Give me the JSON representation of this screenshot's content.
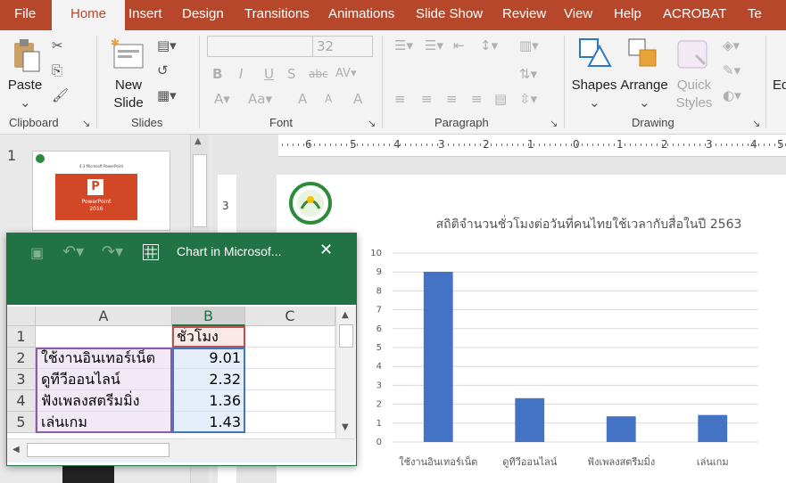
{
  "ribbon_tabs": [
    {
      "label": "File",
      "active": false
    },
    {
      "label": "Home",
      "active": true
    },
    {
      "label": "Insert",
      "active": false
    },
    {
      "label": "Design",
      "active": false
    },
    {
      "label": "Transitions",
      "active": false
    },
    {
      "label": "Animations",
      "active": false
    },
    {
      "label": "Slide Show",
      "active": false
    },
    {
      "label": "Review",
      "active": false
    },
    {
      "label": "View",
      "active": false
    },
    {
      "label": "Help",
      "active": false
    },
    {
      "label": "ACROBAT",
      "active": false
    },
    {
      "label": "Te",
      "active": false
    }
  ],
  "ribbon": {
    "groups": {
      "clipboard": "Clipboard",
      "slides": "Slides",
      "font": "Font",
      "paragraph": "Paragraph",
      "drawing": "Drawing"
    },
    "paste": "Paste",
    "new_slide_line1": "New",
    "new_slide_line2": "Slide",
    "font_size": "32",
    "shapes": "Shapes",
    "arrange": "Arrange",
    "quick_line1": "Quick",
    "quick_line2": "Styles",
    "edit_partial": "Ed"
  },
  "slide_panel": {
    "slide_number": "1",
    "thumb_title": "4.3 Microsoft PowerPoint",
    "thumb_logo_line1": "PowerPoint",
    "thumb_logo_line2": "2016"
  },
  "chart_window": {
    "title": "Chart in Microsof...",
    "columns": [
      "A",
      "B",
      "C"
    ],
    "rows": [
      {
        "num": "1",
        "a": "",
        "b": "ชั่วโมง"
      },
      {
        "num": "2",
        "a": "ใช้งานอินเทอร์เน็ต",
        "b": "9.01"
      },
      {
        "num": "3",
        "a": "ดูทีวีออนไลน์",
        "b": "2.32"
      },
      {
        "num": "4",
        "a": "ฟังเพลงสตรีมมิ่ง",
        "b": "1.36"
      },
      {
        "num": "5",
        "a": "เล่นเกม",
        "b": "1.43"
      }
    ]
  },
  "ruler_numbers": [
    "6",
    "5",
    "4",
    "3",
    "2",
    "1",
    "0",
    "1",
    "2",
    "3",
    "4",
    "5"
  ],
  "ruler_left_label": "3",
  "colors": {
    "ribbon": "#b7472a",
    "excel": "#217346",
    "bar": "#4472c4"
  },
  "chart_data": {
    "type": "bar",
    "title": "สถิติจำนวนชั่วโมงต่อวันที่คนไทยใช้เวลากับสื่อในปี 2563",
    "categories": [
      "ใช้งานอินเทอร์เน็ต",
      "ดูทีวีออนไลน์",
      "ฟังเพลงสตรีมมิ่ง",
      "เล่นเกม"
    ],
    "values": [
      9.01,
      2.32,
      1.36,
      1.43
    ],
    "ylim": [
      0,
      10
    ],
    "yticks": [
      "0",
      "1",
      "2",
      "3",
      "4",
      "5",
      "6",
      "7",
      "8",
      "9",
      "10"
    ],
    "grid": true
  }
}
